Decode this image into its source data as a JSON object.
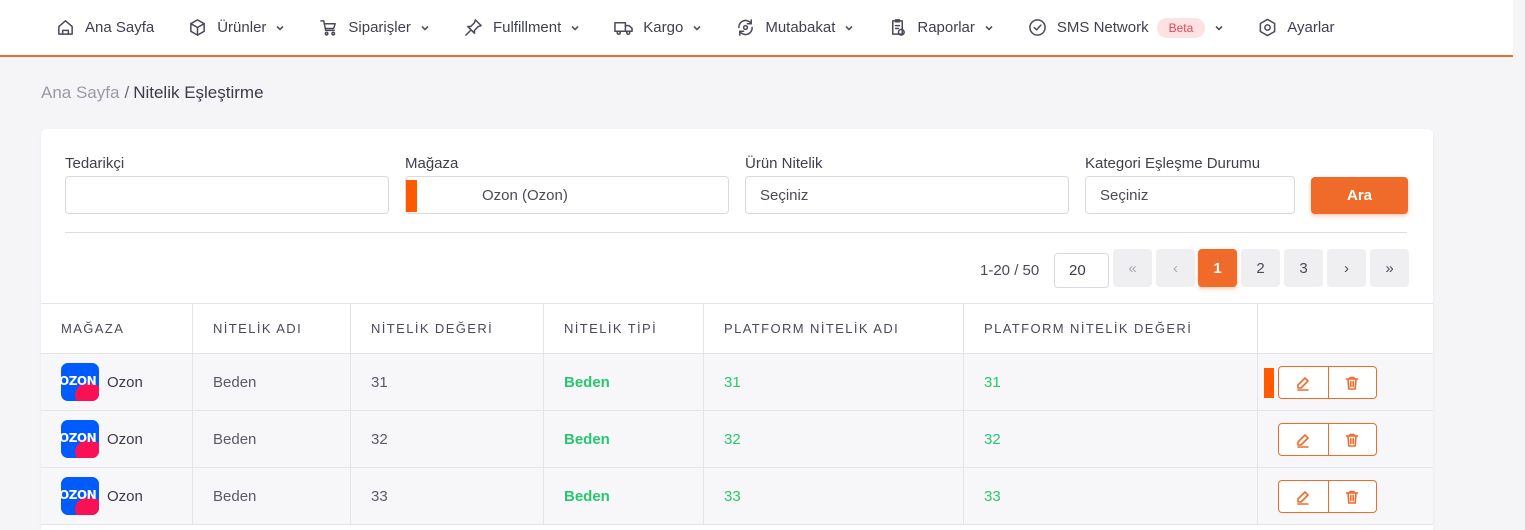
{
  "nav": {
    "items": [
      {
        "label": "Ana Sayfa",
        "icon": "home-icon",
        "dropdown": false
      },
      {
        "label": "Ürünler",
        "icon": "box-icon",
        "dropdown": true
      },
      {
        "label": "Siparişler",
        "icon": "cart-icon",
        "dropdown": true
      },
      {
        "label": "Fulfillment",
        "icon": "pin-icon",
        "dropdown": true
      },
      {
        "label": "Kargo",
        "icon": "truck-icon",
        "dropdown": true
      },
      {
        "label": "Mutabakat",
        "icon": "reconcile-icon",
        "dropdown": true
      },
      {
        "label": "Raporlar",
        "icon": "report-icon",
        "dropdown": true
      },
      {
        "label": "SMS Network",
        "icon": "check-circle-icon",
        "dropdown": true,
        "badge": "Beta"
      },
      {
        "label": "Ayarlar",
        "icon": "settings-icon",
        "dropdown": false
      }
    ]
  },
  "breadcrumb": {
    "home": "Ana Sayfa",
    "separator": "/",
    "current": "Nitelik Eşleştirme"
  },
  "filters": {
    "supplier": {
      "label": "Tedarikçi",
      "value": ""
    },
    "store": {
      "label": "Mağaza",
      "value": "Ozon (Ozon)"
    },
    "attribute": {
      "label": "Ürün Nitelik",
      "value": "Seçiniz"
    },
    "category_status": {
      "label": "Kategori Eşleşme Durumu",
      "value": "Seçiniz"
    },
    "search_button": "Ara"
  },
  "pagination": {
    "info": "1-20 / 50",
    "page_size": "20",
    "first": "«",
    "prev": "‹",
    "next": "›",
    "last": "»",
    "pages": [
      "1",
      "2",
      "3"
    ],
    "active_page": "1"
  },
  "table": {
    "headers": [
      "MAĞAZA",
      "NİTELİK ADI",
      "NİTELİK DEĞERİ",
      "NİTELİK TİPİ",
      "PLATFORM NİTELİK ADI",
      "PLATFORM NİTELİK DEĞERİ",
      ""
    ],
    "rows": [
      {
        "store": "Ozon",
        "logo_text": "OZON",
        "attr_name": "Beden",
        "attr_value": "31",
        "attr_type": "Beden",
        "platform_name": "31",
        "platform_value": "31"
      },
      {
        "store": "Ozon",
        "logo_text": "OZON",
        "attr_name": "Beden",
        "attr_value": "32",
        "attr_type": "Beden",
        "platform_name": "32",
        "platform_value": "32"
      },
      {
        "store": "Ozon",
        "logo_text": "OZON",
        "attr_name": "Beden",
        "attr_value": "33",
        "attr_type": "Beden",
        "platform_name": "33",
        "platform_value": "33"
      }
    ]
  },
  "colors": {
    "accent": "#f06a2a",
    "marker": "#ff5a00",
    "green": "#28c76f",
    "ozon_blue": "#005bff",
    "ozon_pink": "#f91155"
  }
}
